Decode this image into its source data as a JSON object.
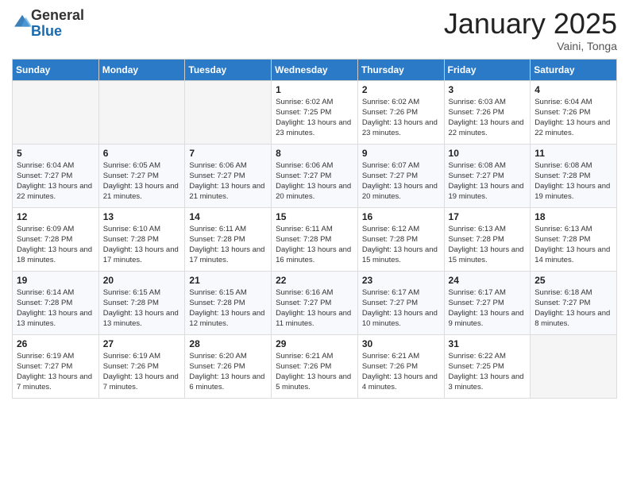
{
  "header": {
    "logo_general": "General",
    "logo_blue": "Blue",
    "month_title": "January 2025",
    "location": "Vaini, Tonga"
  },
  "days_of_week": [
    "Sunday",
    "Monday",
    "Tuesday",
    "Wednesday",
    "Thursday",
    "Friday",
    "Saturday"
  ],
  "weeks": [
    [
      null,
      null,
      null,
      {
        "day": 1,
        "sunrise": "6:02 AM",
        "sunset": "7:25 PM",
        "daylight": "13 hours and 23 minutes."
      },
      {
        "day": 2,
        "sunrise": "6:02 AM",
        "sunset": "7:26 PM",
        "daylight": "13 hours and 23 minutes."
      },
      {
        "day": 3,
        "sunrise": "6:03 AM",
        "sunset": "7:26 PM",
        "daylight": "13 hours and 22 minutes."
      },
      {
        "day": 4,
        "sunrise": "6:04 AM",
        "sunset": "7:26 PM",
        "daylight": "13 hours and 22 minutes."
      }
    ],
    [
      {
        "day": 5,
        "sunrise": "6:04 AM",
        "sunset": "7:27 PM",
        "daylight": "13 hours and 22 minutes."
      },
      {
        "day": 6,
        "sunrise": "6:05 AM",
        "sunset": "7:27 PM",
        "daylight": "13 hours and 21 minutes."
      },
      {
        "day": 7,
        "sunrise": "6:06 AM",
        "sunset": "7:27 PM",
        "daylight": "13 hours and 21 minutes."
      },
      {
        "day": 8,
        "sunrise": "6:06 AM",
        "sunset": "7:27 PM",
        "daylight": "13 hours and 20 minutes."
      },
      {
        "day": 9,
        "sunrise": "6:07 AM",
        "sunset": "7:27 PM",
        "daylight": "13 hours and 20 minutes."
      },
      {
        "day": 10,
        "sunrise": "6:08 AM",
        "sunset": "7:27 PM",
        "daylight": "13 hours and 19 minutes."
      },
      {
        "day": 11,
        "sunrise": "6:08 AM",
        "sunset": "7:28 PM",
        "daylight": "13 hours and 19 minutes."
      }
    ],
    [
      {
        "day": 12,
        "sunrise": "6:09 AM",
        "sunset": "7:28 PM",
        "daylight": "13 hours and 18 minutes."
      },
      {
        "day": 13,
        "sunrise": "6:10 AM",
        "sunset": "7:28 PM",
        "daylight": "13 hours and 17 minutes."
      },
      {
        "day": 14,
        "sunrise": "6:11 AM",
        "sunset": "7:28 PM",
        "daylight": "13 hours and 17 minutes."
      },
      {
        "day": 15,
        "sunrise": "6:11 AM",
        "sunset": "7:28 PM",
        "daylight": "13 hours and 16 minutes."
      },
      {
        "day": 16,
        "sunrise": "6:12 AM",
        "sunset": "7:28 PM",
        "daylight": "13 hours and 15 minutes."
      },
      {
        "day": 17,
        "sunrise": "6:13 AM",
        "sunset": "7:28 PM",
        "daylight": "13 hours and 15 minutes."
      },
      {
        "day": 18,
        "sunrise": "6:13 AM",
        "sunset": "7:28 PM",
        "daylight": "13 hours and 14 minutes."
      }
    ],
    [
      {
        "day": 19,
        "sunrise": "6:14 AM",
        "sunset": "7:28 PM",
        "daylight": "13 hours and 13 minutes."
      },
      {
        "day": 20,
        "sunrise": "6:15 AM",
        "sunset": "7:28 PM",
        "daylight": "13 hours and 13 minutes."
      },
      {
        "day": 21,
        "sunrise": "6:15 AM",
        "sunset": "7:28 PM",
        "daylight": "13 hours and 12 minutes."
      },
      {
        "day": 22,
        "sunrise": "6:16 AM",
        "sunset": "7:27 PM",
        "daylight": "13 hours and 11 minutes."
      },
      {
        "day": 23,
        "sunrise": "6:17 AM",
        "sunset": "7:27 PM",
        "daylight": "13 hours and 10 minutes."
      },
      {
        "day": 24,
        "sunrise": "6:17 AM",
        "sunset": "7:27 PM",
        "daylight": "13 hours and 9 minutes."
      },
      {
        "day": 25,
        "sunrise": "6:18 AM",
        "sunset": "7:27 PM",
        "daylight": "13 hours and 8 minutes."
      }
    ],
    [
      {
        "day": 26,
        "sunrise": "6:19 AM",
        "sunset": "7:27 PM",
        "daylight": "13 hours and 7 minutes."
      },
      {
        "day": 27,
        "sunrise": "6:19 AM",
        "sunset": "7:26 PM",
        "daylight": "13 hours and 7 minutes."
      },
      {
        "day": 28,
        "sunrise": "6:20 AM",
        "sunset": "7:26 PM",
        "daylight": "13 hours and 6 minutes."
      },
      {
        "day": 29,
        "sunrise": "6:21 AM",
        "sunset": "7:26 PM",
        "daylight": "13 hours and 5 minutes."
      },
      {
        "day": 30,
        "sunrise": "6:21 AM",
        "sunset": "7:26 PM",
        "daylight": "13 hours and 4 minutes."
      },
      {
        "day": 31,
        "sunrise": "6:22 AM",
        "sunset": "7:25 PM",
        "daylight": "13 hours and 3 minutes."
      },
      null
    ]
  ]
}
